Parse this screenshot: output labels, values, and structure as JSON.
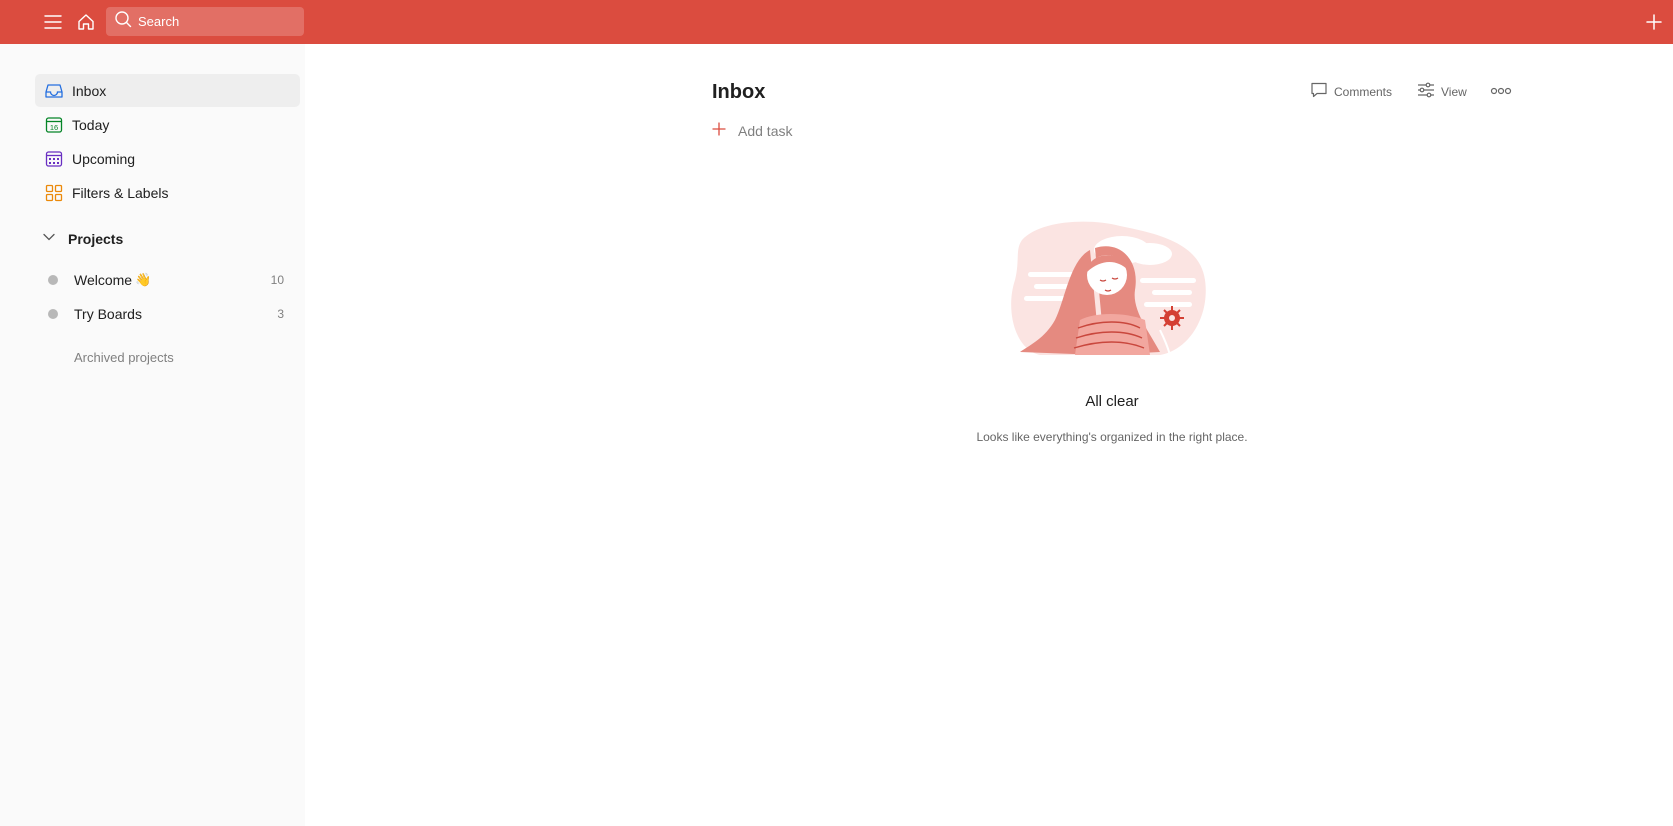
{
  "topbar": {
    "background": "#db4c3f",
    "menu_icon": "menu-icon",
    "home_icon": "home-icon",
    "search_placeholder": "Search",
    "add_icon": "plus-icon"
  },
  "sidebar": {
    "nav": [
      {
        "label": "Inbox",
        "icon": "inbox-icon",
        "color": "#246fe0",
        "active": true
      },
      {
        "label": "Today",
        "icon": "calendar-today-icon",
        "color": "#058527",
        "day": "16"
      },
      {
        "label": "Upcoming",
        "icon": "calendar-upcoming-icon",
        "color": "#692fc2"
      },
      {
        "label": "Filters & Labels",
        "icon": "filters-grid-icon",
        "color": "#eb8909"
      }
    ],
    "projects_label": "Projects",
    "projects": [
      {
        "label": "Welcome",
        "emoji": "👋",
        "count": "10"
      },
      {
        "label": "Try Boards",
        "count": "3"
      }
    ],
    "archived_label": "Archived projects"
  },
  "main": {
    "title": "Inbox",
    "add_task_label": "Add task",
    "actions": {
      "comments": "Comments",
      "view": "View",
      "more_icon": "more-horizontal-icon"
    },
    "empty": {
      "title": "All clear",
      "subtitle": "Looks like everything's organized in the right place."
    },
    "accent": "#db4c3f"
  }
}
